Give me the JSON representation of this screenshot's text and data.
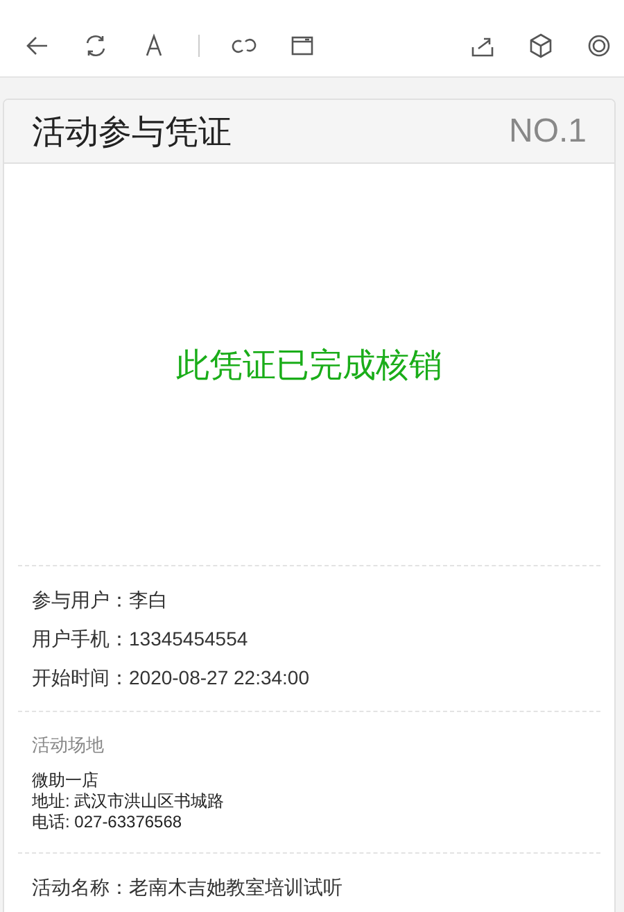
{
  "card": {
    "title": "活动参与凭证",
    "number": "NO.1"
  },
  "status": "此凭证已完成核销",
  "details": [
    "参与用户：李白",
    "用户手机：13345454554",
    "开始时间：2020-08-27 22:34:00"
  ],
  "venue": {
    "heading": "活动场地",
    "lines": [
      "微助一店",
      "地址: 武汉市洪山区书城路",
      "电话: 027-63376568"
    ]
  },
  "activity": "活动名称：老南木吉她教室培训试听"
}
